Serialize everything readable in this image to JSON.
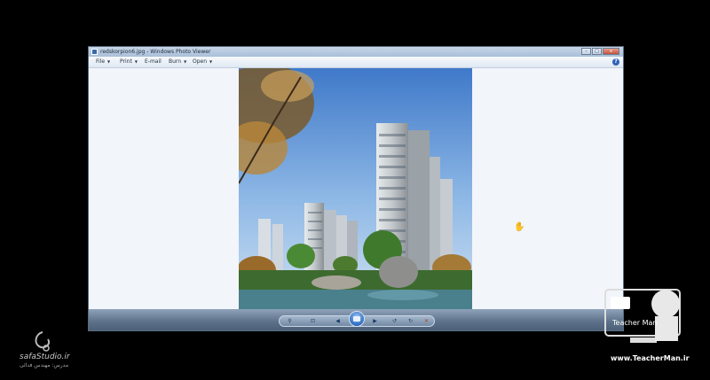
{
  "window": {
    "title": "redskorpion6.jpg - Windows Photo Viewer",
    "controls": {
      "minimize": "–",
      "maximize": "□",
      "close": "x"
    }
  },
  "menu": {
    "items": [
      {
        "label": "File"
      },
      {
        "label": "Print"
      },
      {
        "label": "E-mail"
      },
      {
        "label": "Burn"
      },
      {
        "label": "Open"
      }
    ],
    "help": "?"
  },
  "toolbar": {
    "zoom": "⚲",
    "actual_size": "⊡",
    "previous": "◀",
    "next": "▶",
    "rotate_ccw": "↺",
    "rotate_cw": "↻",
    "delete": "✕"
  },
  "watermarks": {
    "left_brand": "safaStudio.ir",
    "left_sub": "مدرس: مهندس فدائی",
    "right_url": "www.TeacherMan.ir",
    "right_brand": "Teacher Man"
  },
  "colors": {
    "accent": "#2f6ec2",
    "window_bg": "#f1f4f9",
    "taskbar": "#5c7189"
  }
}
